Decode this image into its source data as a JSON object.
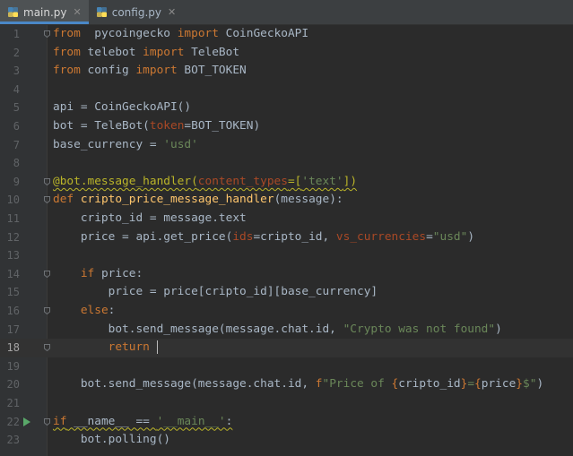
{
  "tabs": [
    {
      "label": "main.py",
      "active": true
    },
    {
      "label": "config.py",
      "active": false
    }
  ],
  "lines": [
    {
      "n": "1",
      "t": [
        [
          "kw",
          "from"
        ],
        [
          "",
          "  pycoingecko "
        ],
        [
          "kw",
          "import"
        ],
        [
          "",
          " CoinGeckoAPI"
        ]
      ]
    },
    {
      "n": "2",
      "t": [
        [
          "kw",
          "from"
        ],
        [
          "",
          " telebot "
        ],
        [
          "kw",
          "import"
        ],
        [
          "",
          " TeleBot"
        ]
      ]
    },
    {
      "n": "3",
      "t": [
        [
          "kw",
          "from"
        ],
        [
          "",
          " config "
        ],
        [
          "kw",
          "import"
        ],
        [
          "",
          " BOT_TOKEN"
        ]
      ]
    },
    {
      "n": "4",
      "t": []
    },
    {
      "n": "5",
      "t": [
        [
          "",
          "api = CoinGeckoAPI()"
        ]
      ]
    },
    {
      "n": "6",
      "t": [
        [
          "",
          "bot = TeleBot("
        ],
        [
          "kwarg",
          "token"
        ],
        [
          "",
          "=BOT_TOKEN)"
        ]
      ]
    },
    {
      "n": "7",
      "t": [
        [
          "",
          "base_currency = "
        ],
        [
          "str",
          "'usd'"
        ]
      ]
    },
    {
      "n": "8",
      "t": []
    },
    {
      "n": "9",
      "t": [
        [
          "dec wavy",
          "@bot.message_handler("
        ],
        [
          "kwarg wavy",
          "content_types"
        ],
        [
          "dec wavy",
          "=["
        ],
        [
          "str wavy",
          "'text'"
        ],
        [
          "dec wavy",
          "])"
        ]
      ]
    },
    {
      "n": "10",
      "t": [
        [
          "kw",
          "def"
        ],
        [
          "",
          " "
        ],
        [
          "fn",
          "cripto_price_message_handler"
        ],
        [
          "",
          "(message):"
        ]
      ]
    },
    {
      "n": "11",
      "t": [
        [
          "",
          "    cripto_id = message.text"
        ]
      ]
    },
    {
      "n": "12",
      "t": [
        [
          "",
          "    price = api.get_price("
        ],
        [
          "kwarg",
          "ids"
        ],
        [
          "",
          "=cripto_id, "
        ],
        [
          "kwarg",
          "vs_currencies"
        ],
        [
          "",
          "="
        ],
        [
          "str",
          "\"usd\""
        ],
        [
          "",
          ")"
        ]
      ]
    },
    {
      "n": "13",
      "t": []
    },
    {
      "n": "14",
      "t": [
        [
          "",
          "    "
        ],
        [
          "kw",
          "if"
        ],
        [
          "",
          " price:"
        ]
      ]
    },
    {
      "n": "15",
      "t": [
        [
          "",
          "        price = price[cripto_id][base_currency]"
        ]
      ]
    },
    {
      "n": "16",
      "t": [
        [
          "",
          "    "
        ],
        [
          "kw",
          "else"
        ],
        [
          "",
          ":"
        ]
      ]
    },
    {
      "n": "17",
      "t": [
        [
          "",
          "        bot.send_message(message.chat.id, "
        ],
        [
          "str",
          "\"Crypto was not found\""
        ],
        [
          "",
          ")"
        ]
      ]
    },
    {
      "n": "18",
      "t": [
        [
          "",
          "        "
        ],
        [
          "kw",
          "return"
        ],
        [
          "",
          " "
        ]
      ]
    },
    {
      "n": "19",
      "t": []
    },
    {
      "n": "20",
      "t": [
        [
          "",
          "    bot.send_message(message.chat.id, "
        ],
        [
          "kw",
          "f"
        ],
        [
          "str",
          "\"Price of "
        ],
        [
          "brace",
          "{"
        ],
        [
          "",
          "cripto_id"
        ],
        [
          "brace",
          "}"
        ],
        [
          "str",
          "="
        ],
        [
          "brace",
          "{"
        ],
        [
          "",
          "price"
        ],
        [
          "brace",
          "}"
        ],
        [
          "str",
          "$\""
        ],
        [
          "",
          ")"
        ]
      ]
    },
    {
      "n": "21",
      "t": []
    },
    {
      "n": "22",
      "t": [
        [
          "kw wavy",
          "if"
        ],
        [
          "wavy",
          " __name__ == "
        ],
        [
          "str wavy",
          "'__main__'"
        ],
        [
          "wavy",
          ":"
        ]
      ]
    },
    {
      "n": "23",
      "t": [
        [
          "",
          "    bot.polling()"
        ]
      ]
    }
  ],
  "current_line": "18",
  "run_line": "22",
  "fold_lines": [
    "1",
    "9",
    "10",
    "14",
    "16",
    "18",
    "22"
  ],
  "colors": {
    "background": "#2b2b2b",
    "keyword": "#cc7832",
    "string": "#6a8759",
    "function": "#ffc66d",
    "decorator": "#bbb529",
    "param": "#aa4926"
  }
}
